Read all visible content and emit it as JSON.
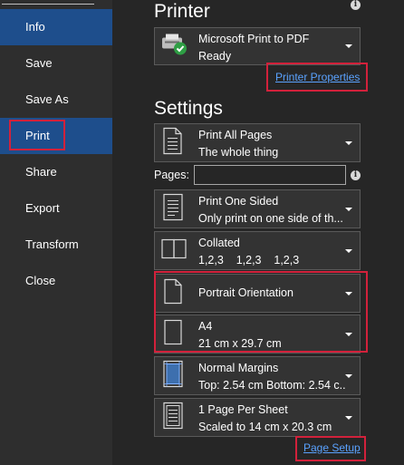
{
  "sidebar": {
    "items": [
      {
        "label": "Info"
      },
      {
        "label": "Save"
      },
      {
        "label": "Save As"
      },
      {
        "label": "Print"
      },
      {
        "label": "Share"
      },
      {
        "label": "Export"
      },
      {
        "label": "Transform"
      },
      {
        "label": "Close"
      }
    ]
  },
  "printer": {
    "heading": "Printer",
    "name": "Microsoft Print to PDF",
    "status": "Ready",
    "properties_link": "Printer Properties"
  },
  "settings": {
    "heading": "Settings",
    "pages_label": "Pages:",
    "pages_value": "",
    "options": [
      {
        "line1": "Print All Pages",
        "line2": "The whole thing",
        "icon": "pages-icon"
      },
      {
        "line1": "Print One Sided",
        "line2": "Only print on one side of th...",
        "icon": "one-sided-icon"
      },
      {
        "line1": "Collated",
        "line2": "1,2,3    1,2,3    1,2,3",
        "icon": "collated-icon"
      },
      {
        "line1": "Portrait Orientation",
        "line2": "",
        "icon": "portrait-icon"
      },
      {
        "line1": "A4",
        "line2": "21 cm x 29.7 cm",
        "icon": "paper-size-icon"
      },
      {
        "line1": "Normal Margins",
        "line2": "Top: 2.54 cm Bottom: 2.54 c...",
        "icon": "margins-icon"
      },
      {
        "line1": "1 Page Per Sheet",
        "line2": "Scaled to 14 cm x 20.3 cm",
        "icon": "pages-per-sheet-icon"
      }
    ],
    "page_setup_link": "Page Setup"
  },
  "colors": {
    "accent_selected": "#1e4e8c",
    "highlight_box": "#d2213b",
    "link": "#5aa2ff"
  }
}
